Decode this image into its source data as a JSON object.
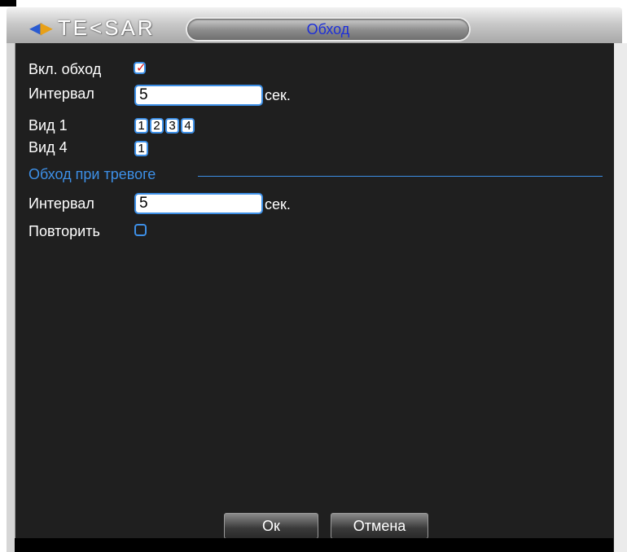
{
  "window": {
    "logo_text": "TE<SAR",
    "title": "Обход"
  },
  "form": {
    "enable_label": "Вкл. обход",
    "enable_checked": true,
    "interval_label": "Интервал",
    "interval_value": "5",
    "interval_unit": "сек.",
    "view1_label": "Вид 1",
    "view1_options": [
      "1",
      "2",
      "3",
      "4"
    ],
    "view4_label": "Вид 4",
    "view4_options": [
      "1"
    ]
  },
  "alarm_section": {
    "title": "Обход при тревоге",
    "interval_label": "Интервал",
    "interval_value": "5",
    "interval_unit": "сек.",
    "repeat_label": "Повторить",
    "repeat_checked": false
  },
  "buttons": {
    "ok_label": "Ок",
    "cancel_label": "Отмена"
  },
  "colors": {
    "accent": "#3d8fe6",
    "title_text": "#1d2fd8",
    "panel_bg": "#1f1f1f",
    "check_mark": "#e01818"
  }
}
